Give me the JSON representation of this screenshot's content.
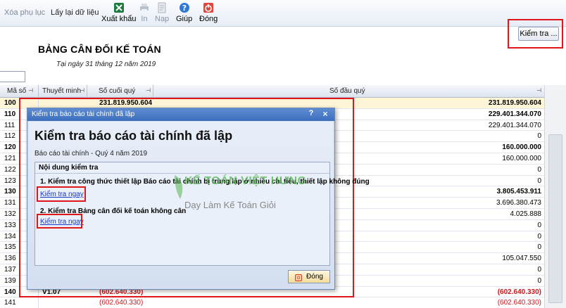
{
  "toolbar": {
    "xoa_phu_luc": "Xóa phụ lục",
    "lay_lai_du_lieu": "Lấy lại dữ liệu",
    "xuat_khau": "Xuất khẩu",
    "in": "In",
    "nap": "Nạp",
    "giup": "Giúp",
    "dong": "Đóng"
  },
  "report": {
    "check_button": "Kiểm tra ...",
    "title": "BẢNG CÂN ĐỐI KẾ TOÁN",
    "subtitle": "Tại ngày 31 tháng 12 năm 2019"
  },
  "grid": {
    "headers": {
      "ma_so": "Mã số",
      "thuyet_minh": "Thuyết minh",
      "so_cuoi_quy": "Số cuối quý",
      "so_dau_quy": "Số đầu quý"
    },
    "rows": [
      {
        "code": "100",
        "mid": "231.819.950.604",
        "val": "231.819.950.604",
        "bold": true,
        "hl": true
      },
      {
        "code": "110",
        "mid": "",
        "val": "229.401.344.070",
        "bold": true
      },
      {
        "code": "111",
        "mid": "",
        "val": "229.401.344.070"
      },
      {
        "code": "112",
        "mid": "",
        "val": "0"
      },
      {
        "code": "120",
        "mid": "",
        "val": "160.000.000",
        "bold": true
      },
      {
        "code": "121",
        "mid": "",
        "val": "160.000.000"
      },
      {
        "code": "122",
        "mid": "",
        "val": "0"
      },
      {
        "code": "123",
        "mid": "",
        "val": "0"
      },
      {
        "code": "130",
        "mid": "",
        "val": "3.805.453.911",
        "bold": true
      },
      {
        "code": "131",
        "mid": "",
        "val": "3.696.380.473"
      },
      {
        "code": "132",
        "mid": "",
        "val": "4.025.888"
      },
      {
        "code": "133",
        "mid": "",
        "val": "0"
      },
      {
        "code": "134",
        "mid": "",
        "val": "0"
      },
      {
        "code": "135",
        "mid": "",
        "val": "0"
      },
      {
        "code": "136",
        "mid": "",
        "val": "105.047.550"
      },
      {
        "code": "137",
        "mid": "",
        "val": "0"
      },
      {
        "code": "139",
        "mid": "",
        "val": "0"
      },
      {
        "code": "140",
        "tm": "V1.07",
        "mid": "(602.640.330)",
        "val": "(602.640.330)",
        "bold": true,
        "red": true
      },
      {
        "code": "141",
        "mid": "(602.640.330)",
        "val": "(602.640.330)",
        "red": true
      }
    ]
  },
  "dialog": {
    "title": "Kiểm tra báo cáo tài chính đã lập",
    "heading": "Kiểm tra báo cáo tài chính đã lập",
    "sub": "Báo cáo tài chính - Quý 4 năm 2019",
    "group_title": "Nội dung kiểm tra",
    "item1": "1. Kiểm tra công thức thiết lập Báo cáo tài chính bị trùng lặp ở nhiều chỉ tiêu, thiết lập không đúng",
    "item2": "2. Kiểm tra Bảng cân đối kế toán không cân",
    "link": "Kiểm tra ngay",
    "help": "?",
    "close": "×",
    "close_button": "Đóng",
    "watermark": "KẾ TOÁN VIỆT HƯNG",
    "watermark_sub": "Dạy Làm Kế Toán Giỏi"
  },
  "colors": {
    "highlight_red": "#e0161b",
    "link_blue": "#1a36c7",
    "title_bar": "#3c6fbd",
    "brand_green": "#54b44f"
  }
}
